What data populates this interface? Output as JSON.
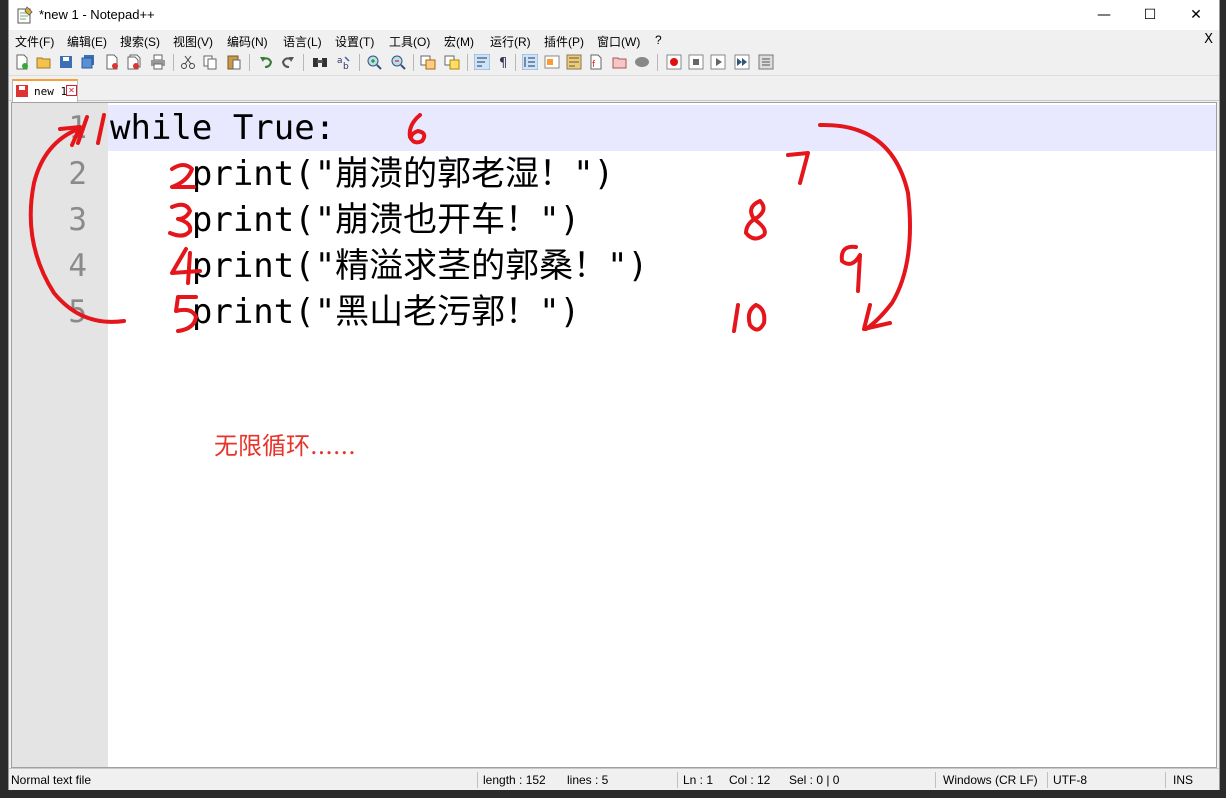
{
  "window": {
    "title": "*new 1 - Notepad++",
    "minimize": "—",
    "maximize": "☐",
    "close": "✕"
  },
  "menu": {
    "items": [
      "文件(F)",
      "编辑(E)",
      "搜索(S)",
      "视图(V)",
      "编码(N)",
      "语言(L)",
      "设置(T)",
      "工具(O)",
      "宏(M)",
      "运行(R)",
      "插件(P)",
      "窗口(W)",
      "?"
    ],
    "close_label": "X"
  },
  "tab": {
    "label": "new 1"
  },
  "editor": {
    "line_numbers": [
      "1",
      "2",
      "3",
      "4",
      "5"
    ],
    "lines": [
      "while True:",
      "    print(\"崩溃的郭老湿！\")",
      "    print(\"崩溃也开车！\")",
      "    print(\"精溢求茎的郭桑！\")",
      "    print(\"黑山老污郭！\")"
    ],
    "note": "无限循环......"
  },
  "status": {
    "file_type": "Normal text file",
    "length": "length : 152",
    "lines": "lines : 5",
    "ln": "Ln : 1",
    "col": "Col : 12",
    "sel": "Sel : 0 | 0",
    "eol": "Windows (CR LF)",
    "encoding": "UTF-8",
    "mode": "INS"
  },
  "colors": {
    "annotation_red": "#e4161b",
    "current_line": "#e8e8ff",
    "gutter": "#e4e4e4"
  }
}
